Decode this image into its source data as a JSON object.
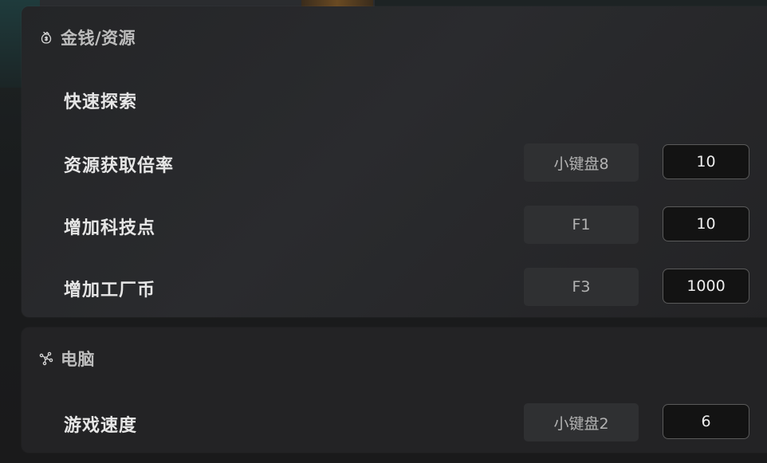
{
  "sections": [
    {
      "icon": "money-bag-icon",
      "title": "金钱/资源",
      "rows": [
        {
          "label": "快速探索"
        },
        {
          "label": "资源获取倍率",
          "hotkey": "小键盘8",
          "value": "10"
        },
        {
          "label": "增加科技点",
          "hotkey": "F1",
          "value": "10"
        },
        {
          "label": "增加工厂币",
          "hotkey": "F3",
          "value": "1000"
        }
      ]
    },
    {
      "icon": "network-nodes-icon",
      "title": "电脑",
      "rows": [
        {
          "label": "游戏速度",
          "hotkey": "小键盘2",
          "value": "6"
        }
      ]
    }
  ],
  "colors": {
    "card_bg": "#2a2b2e",
    "hotkey_bg": "#2f3032",
    "input_bg": "#131313",
    "input_border": "#5a5a5a",
    "label_text": "#e6e6e6",
    "header_text": "#bdbdbd"
  }
}
